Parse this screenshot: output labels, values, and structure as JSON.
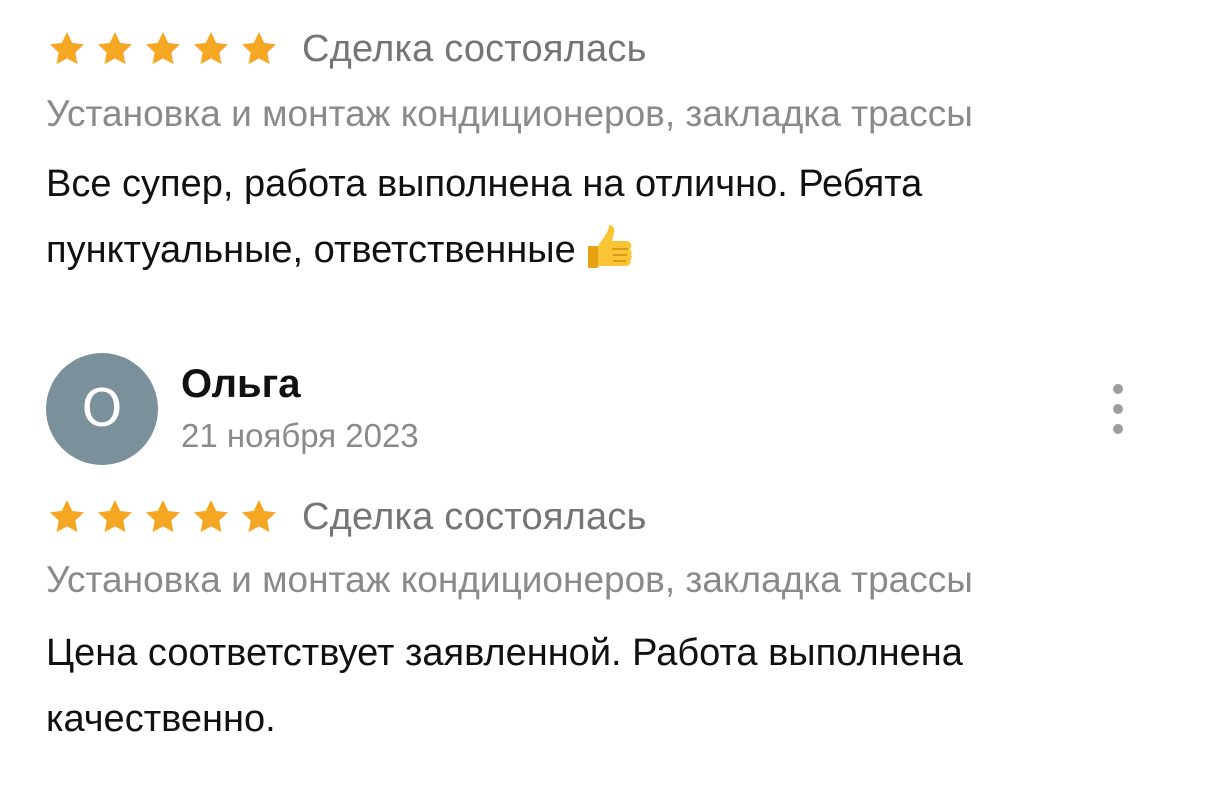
{
  "reviews": [
    {
      "rating": 5,
      "deal_status": "Сделка состоялась",
      "service": "Установка и монтаж кондиционеров, закладка трассы",
      "text": "Все супер, работа выполнена на отлично. Ребята пунктуальные, ответственные",
      "emoji_icon": "thumbs-up-icon"
    },
    {
      "author": {
        "name": "Ольга",
        "initial": "О",
        "date": "21 ноября 2023",
        "avatar_color": "#7a909a"
      },
      "rating": 5,
      "deal_status": "Сделка состоялась",
      "service": "Установка и монтаж кондиционеров, закладка трассы",
      "text": "Цена соответствует заявленной. Работа выполнена качественно."
    }
  ],
  "icons": {
    "star_icon": "star-icon",
    "more_icon": "more-vertical-icon"
  },
  "colors": {
    "star": "#f5a623",
    "secondary_text": "#8a8a8a",
    "primary_text": "#111111"
  }
}
